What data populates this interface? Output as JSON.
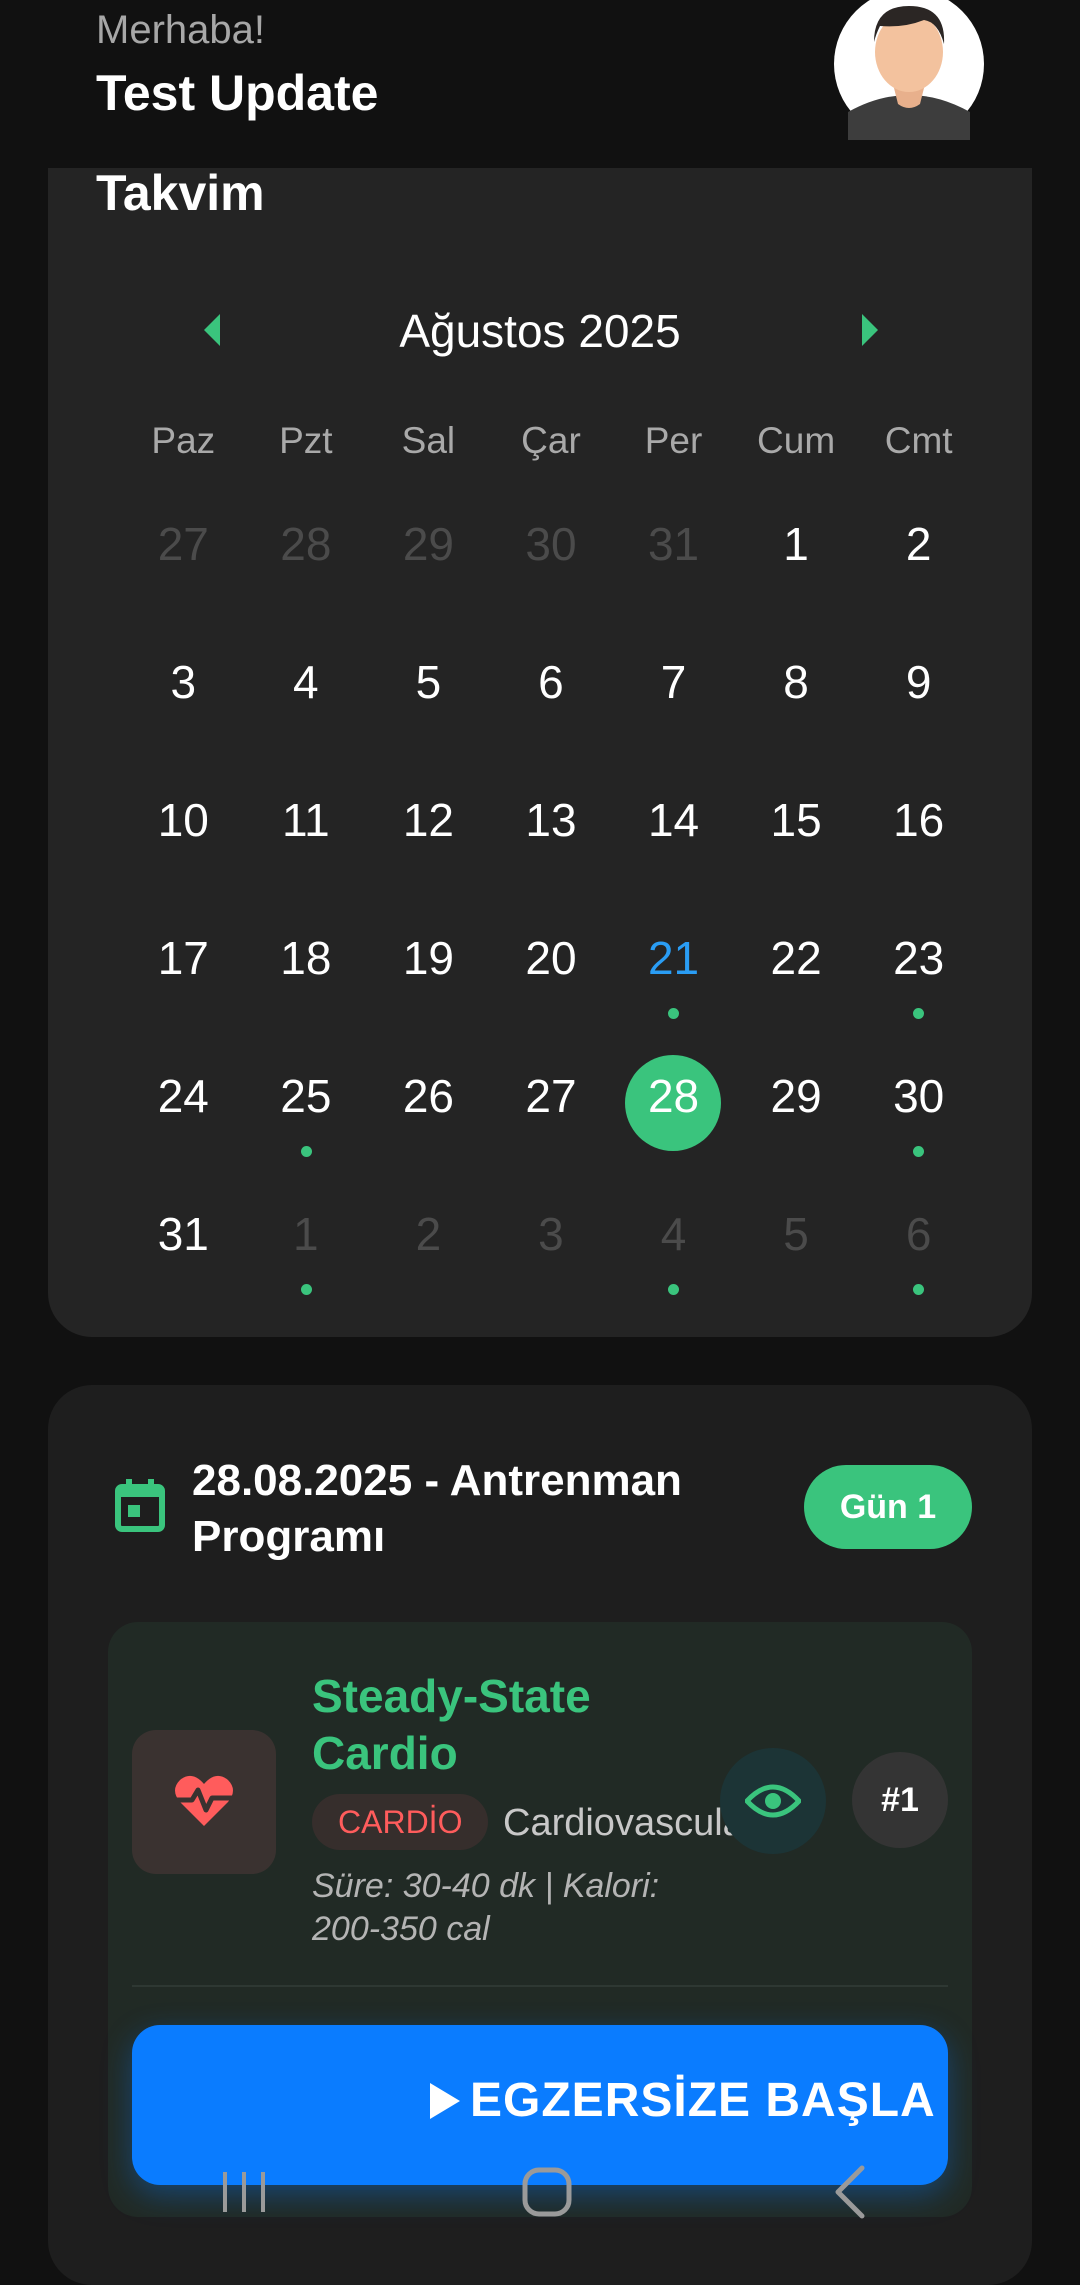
{
  "header": {
    "greeting": "Merhaba!",
    "username": "Test Update"
  },
  "calendar": {
    "title": "Takvim",
    "month_label": "Ağustos 2025",
    "weekdays": [
      "Paz",
      "Pzt",
      "Sal",
      "Çar",
      "Per",
      "Cum",
      "Cmt"
    ],
    "days": [
      {
        "n": "27",
        "other": true,
        "dot": false
      },
      {
        "n": "28",
        "other": true,
        "dot": false
      },
      {
        "n": "29",
        "other": true,
        "dot": false
      },
      {
        "n": "30",
        "other": true,
        "dot": false
      },
      {
        "n": "31",
        "other": true,
        "dot": false
      },
      {
        "n": "1",
        "other": false,
        "dot": false
      },
      {
        "n": "2",
        "other": false,
        "dot": false
      },
      {
        "n": "3",
        "other": false,
        "dot": false
      },
      {
        "n": "4",
        "other": false,
        "dot": false
      },
      {
        "n": "5",
        "other": false,
        "dot": false
      },
      {
        "n": "6",
        "other": false,
        "dot": false
      },
      {
        "n": "7",
        "other": false,
        "dot": false
      },
      {
        "n": "8",
        "other": false,
        "dot": false
      },
      {
        "n": "9",
        "other": false,
        "dot": false
      },
      {
        "n": "10",
        "other": false,
        "dot": false
      },
      {
        "n": "11",
        "other": false,
        "dot": false
      },
      {
        "n": "12",
        "other": false,
        "dot": false
      },
      {
        "n": "13",
        "other": false,
        "dot": false
      },
      {
        "n": "14",
        "other": false,
        "dot": false
      },
      {
        "n": "15",
        "other": false,
        "dot": false
      },
      {
        "n": "16",
        "other": false,
        "dot": false
      },
      {
        "n": "17",
        "other": false,
        "dot": false
      },
      {
        "n": "18",
        "other": false,
        "dot": false
      },
      {
        "n": "19",
        "other": false,
        "dot": false
      },
      {
        "n": "20",
        "other": false,
        "dot": false
      },
      {
        "n": "21",
        "other": false,
        "dot": true,
        "today": true
      },
      {
        "n": "22",
        "other": false,
        "dot": false
      },
      {
        "n": "23",
        "other": false,
        "dot": true
      },
      {
        "n": "24",
        "other": false,
        "dot": false
      },
      {
        "n": "25",
        "other": false,
        "dot": true
      },
      {
        "n": "26",
        "other": false,
        "dot": false
      },
      {
        "n": "27",
        "other": false,
        "dot": false
      },
      {
        "n": "28",
        "other": false,
        "dot": false,
        "selected": true
      },
      {
        "n": "29",
        "other": false,
        "dot": false
      },
      {
        "n": "30",
        "other": false,
        "dot": true
      },
      {
        "n": "31",
        "other": false,
        "dot": false
      },
      {
        "n": "1",
        "other": true,
        "dot": true
      },
      {
        "n": "2",
        "other": true,
        "dot": false
      },
      {
        "n": "3",
        "other": true,
        "dot": false
      },
      {
        "n": "4",
        "other": true,
        "dot": true
      },
      {
        "n": "5",
        "other": true,
        "dot": false
      },
      {
        "n": "6",
        "other": true,
        "dot": true
      }
    ]
  },
  "program": {
    "title": "28.08.2025 - Antrenman Programı",
    "day_badge": "Gün 1",
    "exercise": {
      "name": "Steady-State Cardio",
      "category": "CARDİO",
      "muscle": "Cardiovascular",
      "meta": "Süre: 30-40 dk | Kalori: 200-350 cal",
      "rank": "#1",
      "start_label": "EGZERSİZE BAŞLA"
    }
  },
  "colors": {
    "accent_green": "#3ac47d",
    "primary_blue": "#0a7cff",
    "today_blue": "#2a9df4",
    "cardio_red": "#ff5c5c"
  },
  "icons": [
    "avatar",
    "chevron-left-icon",
    "chevron-right-icon",
    "calendar-icon",
    "heart-pulse-icon",
    "eye-icon",
    "play-icon",
    "recent-apps-icon",
    "home-icon",
    "back-icon"
  ]
}
